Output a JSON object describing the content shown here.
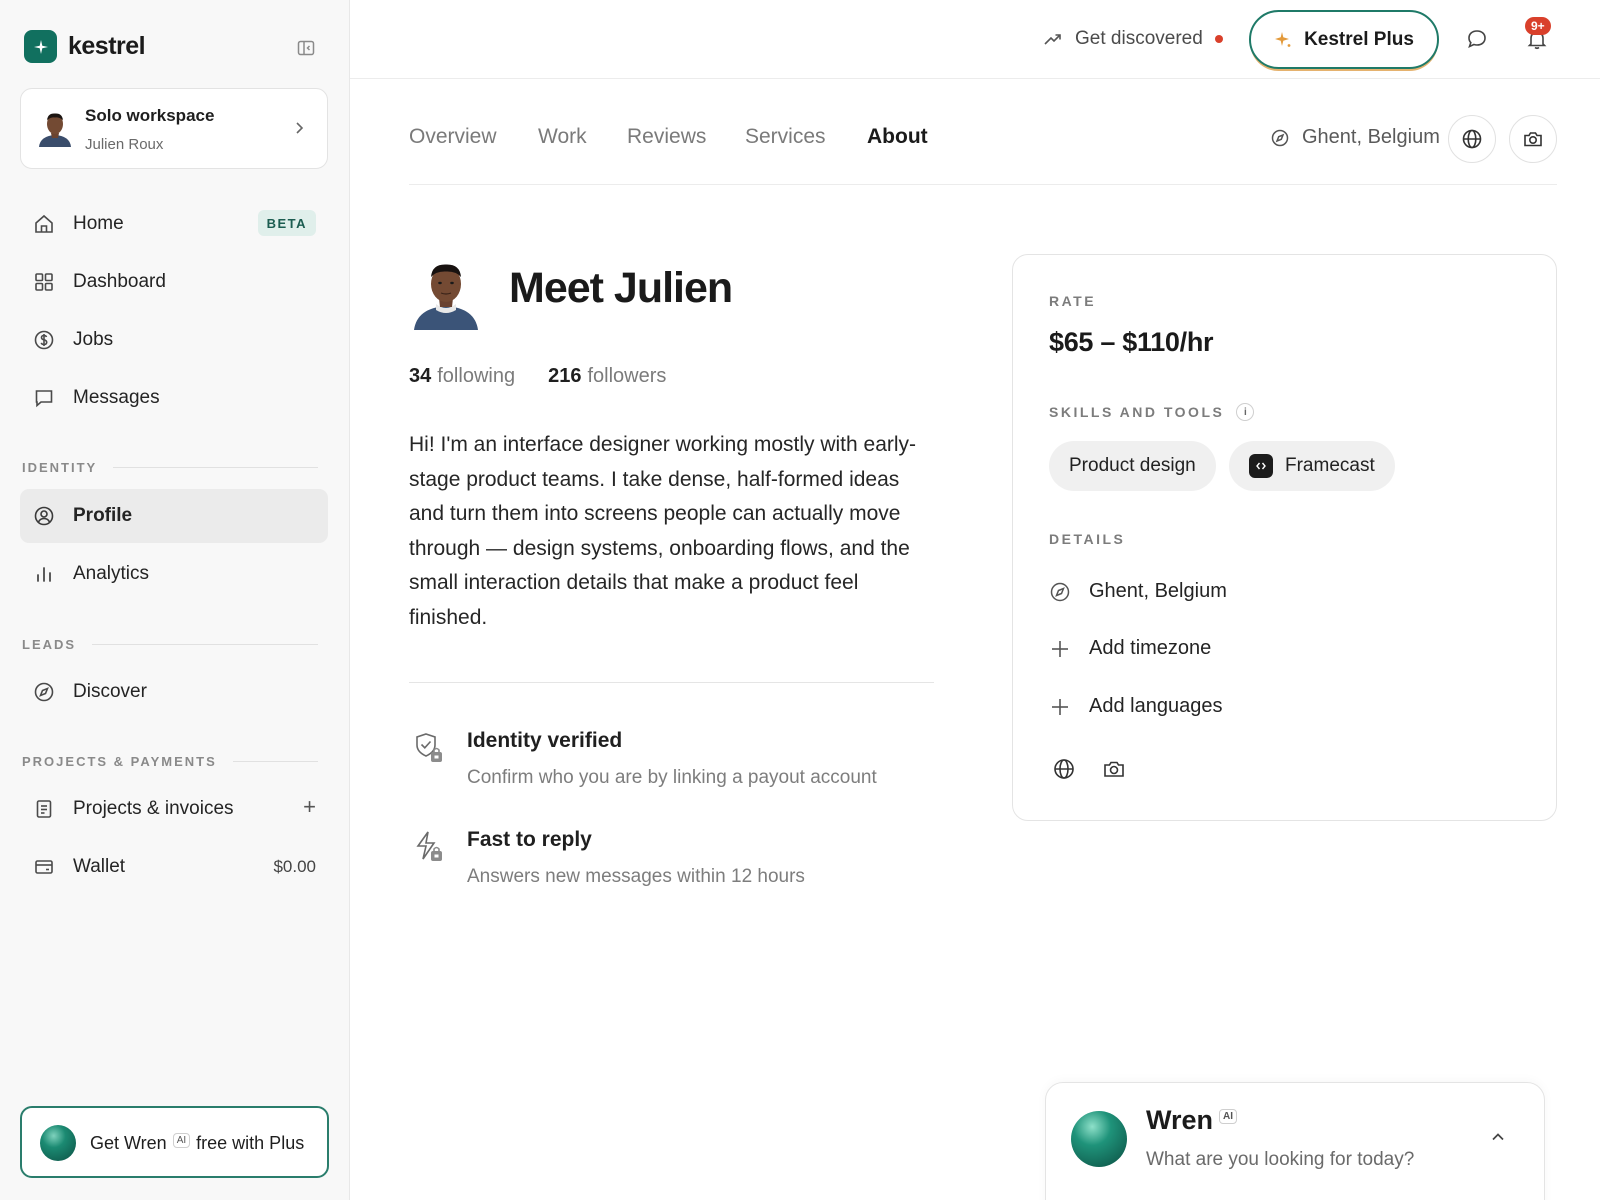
{
  "app": {
    "brand": "kestrel"
  },
  "workspace": {
    "title": "Solo workspace",
    "user": "Julien Roux"
  },
  "nav": {
    "main": [
      {
        "label": "Home",
        "badge": "BETA",
        "icon": "home-icon"
      },
      {
        "label": "Dashboard",
        "icon": "dashboard-grid-icon"
      },
      {
        "label": "Jobs",
        "icon": "dollar-circle-icon"
      },
      {
        "label": "Messages",
        "icon": "chat-bubble-icon"
      }
    ],
    "identity_heading": "IDENTITY",
    "identity": [
      {
        "label": "Profile",
        "active": true,
        "icon": "user-circle-icon"
      },
      {
        "label": "Analytics",
        "icon": "bar-chart-icon"
      }
    ],
    "leads_heading": "LEADS",
    "leads": [
      {
        "label": "Discover",
        "icon": "compass-icon"
      }
    ],
    "projects_heading": "PROJECTS & PAYMENTS",
    "projects": [
      {
        "label": "Projects & invoices",
        "icon": "document-icon",
        "action": "+"
      },
      {
        "label": "Wallet",
        "icon": "wallet-icon",
        "value": "$0.00"
      }
    ]
  },
  "promo": {
    "prefix": "Get Wren",
    "ai": "AI",
    "suffix": "free with Plus"
  },
  "header": {
    "discover_label": "Get discovered",
    "plus_label": "Kestrel Plus",
    "notification_count": "9+"
  },
  "tabs": [
    {
      "label": "Overview"
    },
    {
      "label": "Work"
    },
    {
      "label": "Reviews"
    },
    {
      "label": "Services"
    },
    {
      "label": "About",
      "active": true
    }
  ],
  "location": "Ghent, Belgium",
  "profile": {
    "heading": "Meet Julien",
    "following_count": "34",
    "following_label": "following",
    "followers_count": "216",
    "followers_label": "followers",
    "bio": "Hi! I'm an interface designer working mostly with early-stage product teams. I take dense, half-formed ideas and turn them into screens people can actually move through — design systems, onboarding flows, and the small interaction details that make a product feel finished.",
    "trust": [
      {
        "title": "Identity verified",
        "desc": "Confirm who you are by linking a payout account",
        "icon": "shield-check-icon"
      },
      {
        "title": "Fast to reply",
        "desc": "Answers new messages within 12 hours",
        "icon": "lightning-icon"
      }
    ]
  },
  "card": {
    "rate_label": "RATE",
    "rate": "$65 – $110/hr",
    "skills_label": "SKILLS AND TOOLS",
    "info": "i",
    "skills": [
      "Product design",
      "Framecast"
    ],
    "details_label": "DETAILS",
    "details": [
      "Ghent, Belgium",
      "Add timezone",
      "Add languages"
    ]
  },
  "wren": {
    "name": "Wren",
    "ai": "AI",
    "prompt": "What are you looking for today?"
  },
  "colors": {
    "brand": "#11705f",
    "accent_red": "#d9402b",
    "badge_bg": "#e0efeb"
  }
}
